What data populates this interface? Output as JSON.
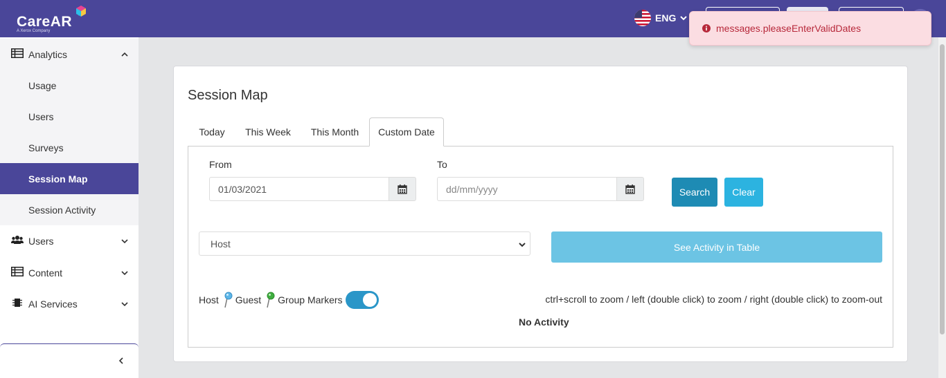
{
  "brand": {
    "name": "CareAR",
    "name_prefix": "Care",
    "name_suffix": "AR",
    "trademark": "™",
    "tagline": "A Xerox Company"
  },
  "header": {
    "language": "ENG"
  },
  "toast": {
    "message": "messages.pleaseEnterValidDates",
    "color": "#b7283a"
  },
  "sidebar": {
    "items": [
      {
        "label": "Analytics",
        "icon": "table-icon",
        "chevron": "up"
      },
      {
        "label": "Usage"
      },
      {
        "label": "Users"
      },
      {
        "label": "Surveys"
      },
      {
        "label": "Session Map",
        "active": true
      },
      {
        "label": "Session Activity"
      },
      {
        "label": "Users",
        "icon": "users-icon",
        "chevron": "down"
      },
      {
        "label": "Content",
        "icon": "table-icon",
        "chevron": "down"
      },
      {
        "label": "AI Services",
        "icon": "chip-icon",
        "chevron": "down"
      }
    ],
    "collapse_icon": "chevron-left-icon"
  },
  "main": {
    "title": "Session Map",
    "tabs": [
      {
        "label": "Today"
      },
      {
        "label": "This Week"
      },
      {
        "label": "This Month"
      },
      {
        "label": "Custom Date",
        "active": true
      }
    ],
    "from_label": "From",
    "from_value": "01/03/2021",
    "to_label": "To",
    "to_placeholder": "dd/mm/yyyy",
    "search_label": "Search",
    "clear_label": "Clear",
    "select_value": "Host",
    "activity_button": "See Activity in Table",
    "legend": {
      "host": "Host",
      "guest": "Guest",
      "group_markers": "Group Markers",
      "group_markers_enabled": true
    },
    "zoom_hint": "ctrl+scroll to zoom / left (double click) to zoom / right (double click) to zoom-out",
    "no_activity": "No Activity"
  },
  "colors": {
    "brand": "#4a4699",
    "search": "#1e8bb4",
    "clear": "#2cb3e0",
    "activity": "#6cc4e4"
  }
}
